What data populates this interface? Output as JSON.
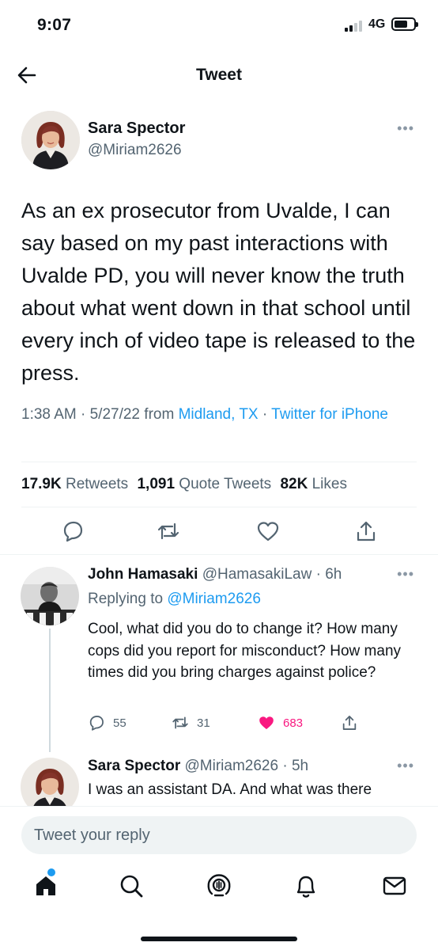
{
  "status_bar": {
    "time": "9:07",
    "network": "4G"
  },
  "header": {
    "title": "Tweet"
  },
  "main_tweet": {
    "author_name": "Sara Spector",
    "author_handle": "@Miriam2626",
    "text": "As an ex prosecutor from Uvalde, I can say based on my past interactions with Uvalde PD, you will never know the truth about what went down in that school until every inch of video tape is released to the press.",
    "time": "1:38 AM",
    "date": "5/27/22",
    "from_label": "from",
    "location": "Midland, TX",
    "source": "Twitter for iPhone",
    "retweets_count": "17.9K",
    "retweets_label": "Retweets",
    "quotes_count": "1,091",
    "quotes_label": "Quote Tweets",
    "likes_count": "82K",
    "likes_label": "Likes"
  },
  "replies": [
    {
      "name": "John Hamasaki",
      "handle": "@HamasakiLaw",
      "age": "6h",
      "replying_label": "Replying to",
      "replying_to": "@Miriam2626",
      "text": "Cool, what did you do to change it? How many cops did you report for misconduct? How many times did you bring charges against police?",
      "reply_count": "55",
      "retweet_count": "31",
      "like_count": "683"
    },
    {
      "name": "Sara Spector",
      "handle": "@Miriam2626",
      "age": "5h",
      "text": "I was an assistant DA. And what was there"
    }
  ],
  "composer": {
    "placeholder": "Tweet your reply"
  },
  "colors": {
    "accent": "#1d9bf0",
    "like": "#f91880",
    "text": "#0f1419",
    "muted": "#536471"
  },
  "icons": {
    "back": "arrow-left-icon",
    "more": "more-horizontal-icon",
    "reply": "comment-icon",
    "retweet": "retweet-icon",
    "like": "heart-icon",
    "share": "share-icon",
    "tabs": [
      "home-icon",
      "search-icon",
      "spaces-icon",
      "bell-icon",
      "mail-icon"
    ]
  }
}
